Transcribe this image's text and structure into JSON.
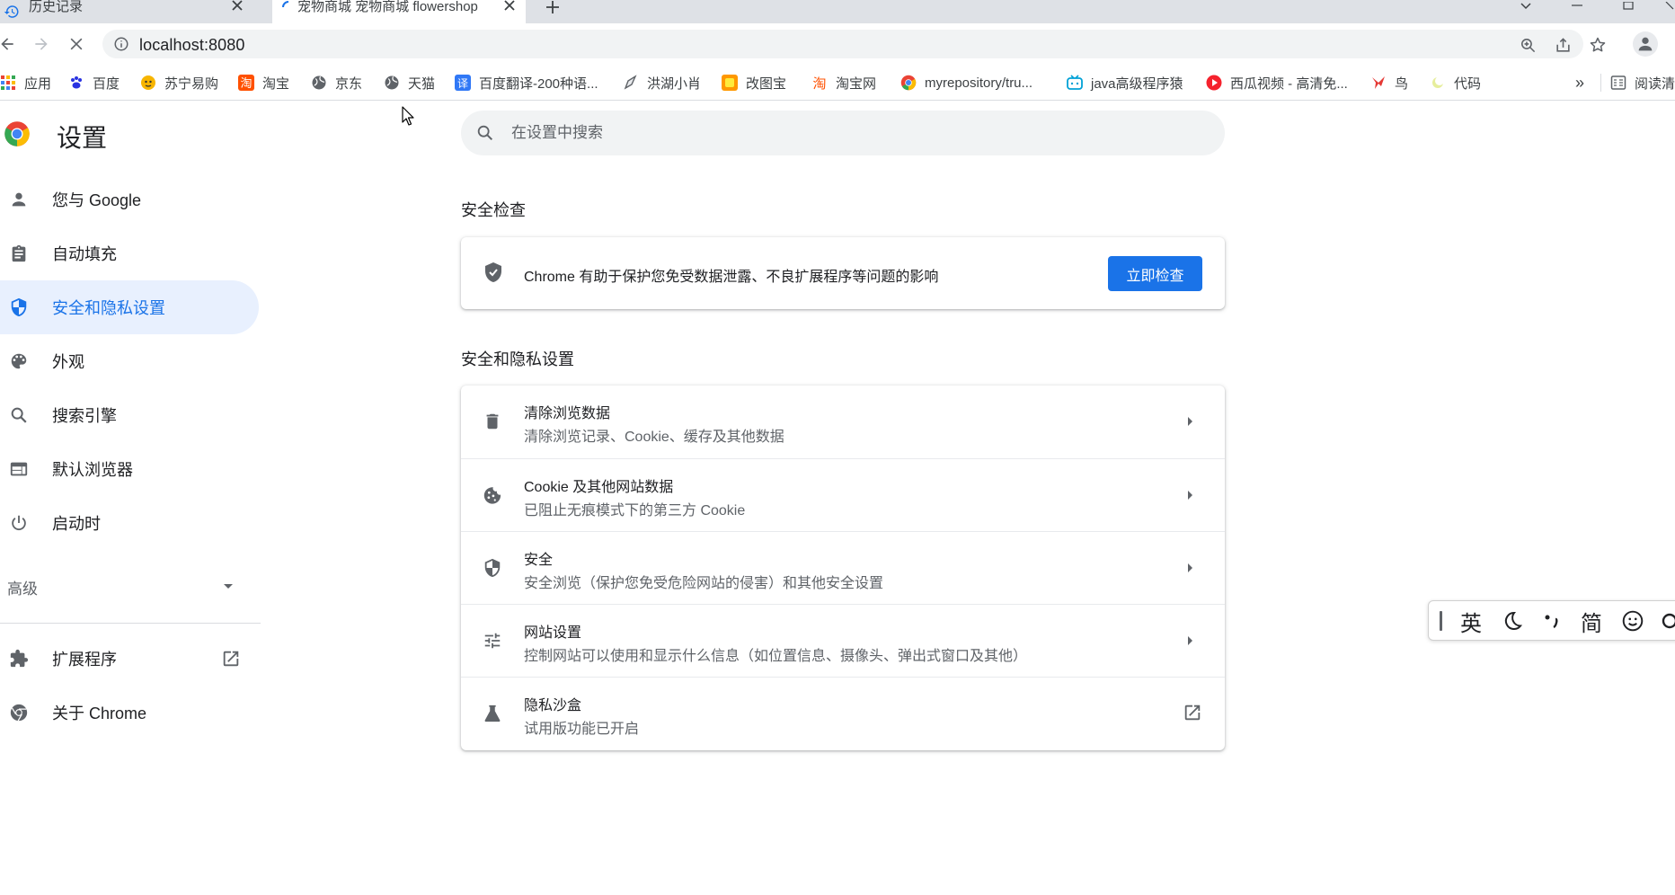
{
  "tabs": [
    {
      "title": "历史记录",
      "active": false
    },
    {
      "title": "宠物商城 宠物商城 flowershop",
      "active": true
    }
  ],
  "address_bar": {
    "url": "localhost:8080"
  },
  "bookmarks": [
    {
      "label": "应用",
      "icon": "apps-grid-icon"
    },
    {
      "label": "百度",
      "icon": "baidu-paw-icon"
    },
    {
      "label": "苏宁易购",
      "icon": "suning-lion-icon"
    },
    {
      "label": "淘宝",
      "icon": "taobao-icon"
    },
    {
      "label": "京东",
      "icon": "globe-icon"
    },
    {
      "label": "天猫",
      "icon": "globe-icon"
    },
    {
      "label": "百度翻译-200种语...",
      "icon": "translate-icon"
    },
    {
      "label": "洪湖小肖",
      "icon": "pen-icon"
    },
    {
      "label": "改图宝",
      "icon": "gaitubao-icon"
    },
    {
      "label": "淘宝网",
      "icon": "taobao-icon"
    },
    {
      "label": "myrepository/tru...",
      "icon": "chrome-icon"
    },
    {
      "label": "java高级程序猿",
      "icon": "bilibili-icon"
    },
    {
      "label": "西瓜视频 - 高清免...",
      "icon": "xigua-icon"
    },
    {
      "label": "鸟",
      "icon": "bird-icon"
    },
    {
      "label": "代码",
      "icon": "moon-icon"
    }
  ],
  "bookmarks_more": "»",
  "reading_list": "阅读清",
  "settings": {
    "title": "设置",
    "nav": [
      {
        "label": "您与 Google",
        "icon": "person-icon",
        "selected": false
      },
      {
        "label": "自动填充",
        "icon": "clipboard-icon",
        "selected": false
      },
      {
        "label": "安全和隐私设置",
        "icon": "shield-icon",
        "selected": true
      },
      {
        "label": "外观",
        "icon": "palette-icon",
        "selected": false
      },
      {
        "label": "搜索引擎",
        "icon": "search-icon",
        "selected": false
      },
      {
        "label": "默认浏览器",
        "icon": "browser-icon",
        "selected": false
      },
      {
        "label": "启动时",
        "icon": "power-icon",
        "selected": false
      }
    ],
    "advanced": "高级",
    "extensions": "扩展程序",
    "about": "关于 Chrome",
    "search_placeholder": "在设置中搜索",
    "safety_check": {
      "heading": "安全检查",
      "text": "Chrome 有助于保护您免受数据泄露、不良扩展程序等问题的影响",
      "button": "立即检查"
    },
    "privacy": {
      "heading": "安全和隐私设置",
      "items": [
        {
          "title": "清除浏览数据",
          "subtitle": "清除浏览记录、Cookie、缓存及其他数据",
          "icon": "trash-icon"
        },
        {
          "title": "Cookie 及其他网站数据",
          "subtitle": "已阻止无痕模式下的第三方 Cookie",
          "icon": "cookie-icon"
        },
        {
          "title": "安全",
          "subtitle": "安全浏览（保护您免受危险网站的侵害）和其他安全设置",
          "icon": "shield-check-icon"
        },
        {
          "title": "网站设置",
          "subtitle": "控制网站可以使用和显示什么信息（如位置信息、摄像头、弹出式窗口及其他）",
          "icon": "tune-icon"
        },
        {
          "title": "隐私沙盒",
          "subtitle": "试用版功能已开启",
          "icon": "flask-icon"
        }
      ]
    }
  },
  "ime": {
    "lang": "英",
    "simplified": "简"
  },
  "colors": {
    "accent": "#1a73e8",
    "selected_bg": "#e8f0fe",
    "icon": "#5f6368"
  }
}
